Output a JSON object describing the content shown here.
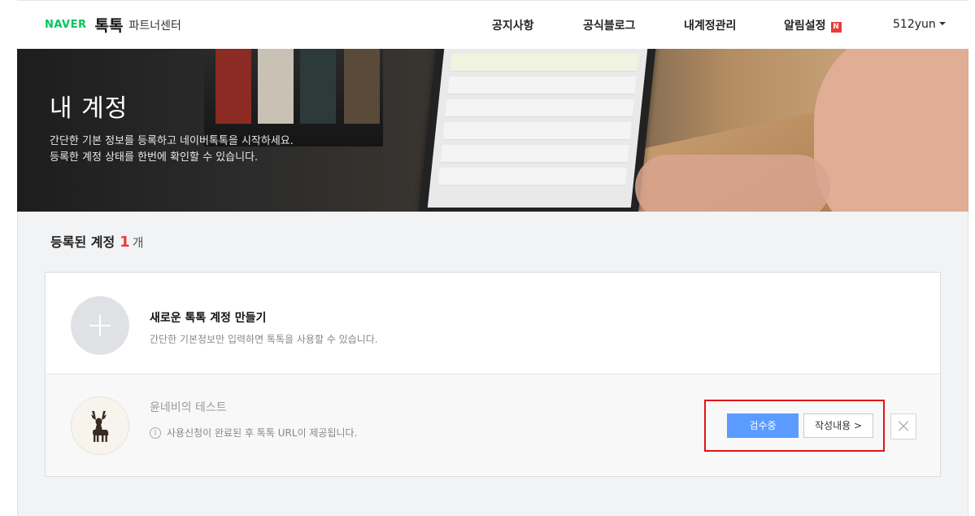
{
  "header": {
    "naver": "NAVER",
    "brand": "톡톡",
    "partner": "파트너센터",
    "nav": [
      "공지사항",
      "공식블로그",
      "내계정관리",
      "알림설정"
    ],
    "notify_badge": "N",
    "user": "512yun"
  },
  "hero": {
    "title": "내 계정",
    "desc_line1": "간단한 기본 정보를 등록하고 네이버톡톡을 시작하세요.",
    "desc_line2": "등록한 계정 상태를 한번에 확인할 수 있습니다."
  },
  "registered": {
    "label": "등록된 계정",
    "count": "1",
    "unit": "개"
  },
  "new_account": {
    "title": "새로운 톡톡 계정 만들기",
    "subtitle": "간단한 기본정보만 입력하면 톡톡을 사용할 수 있습니다."
  },
  "account": {
    "name": "윤네비의 테스트",
    "info": "사용신청이 완료된 후 톡톡 URL이 제공됩니다.",
    "status_button": "검수중",
    "content_button": "작성내용 >",
    "info_icon": "i"
  },
  "colors": {
    "naver_green": "#03c75a",
    "accent_red": "#f03a3a",
    "review_blue": "#5b9bff",
    "highlight": "#e01414"
  }
}
